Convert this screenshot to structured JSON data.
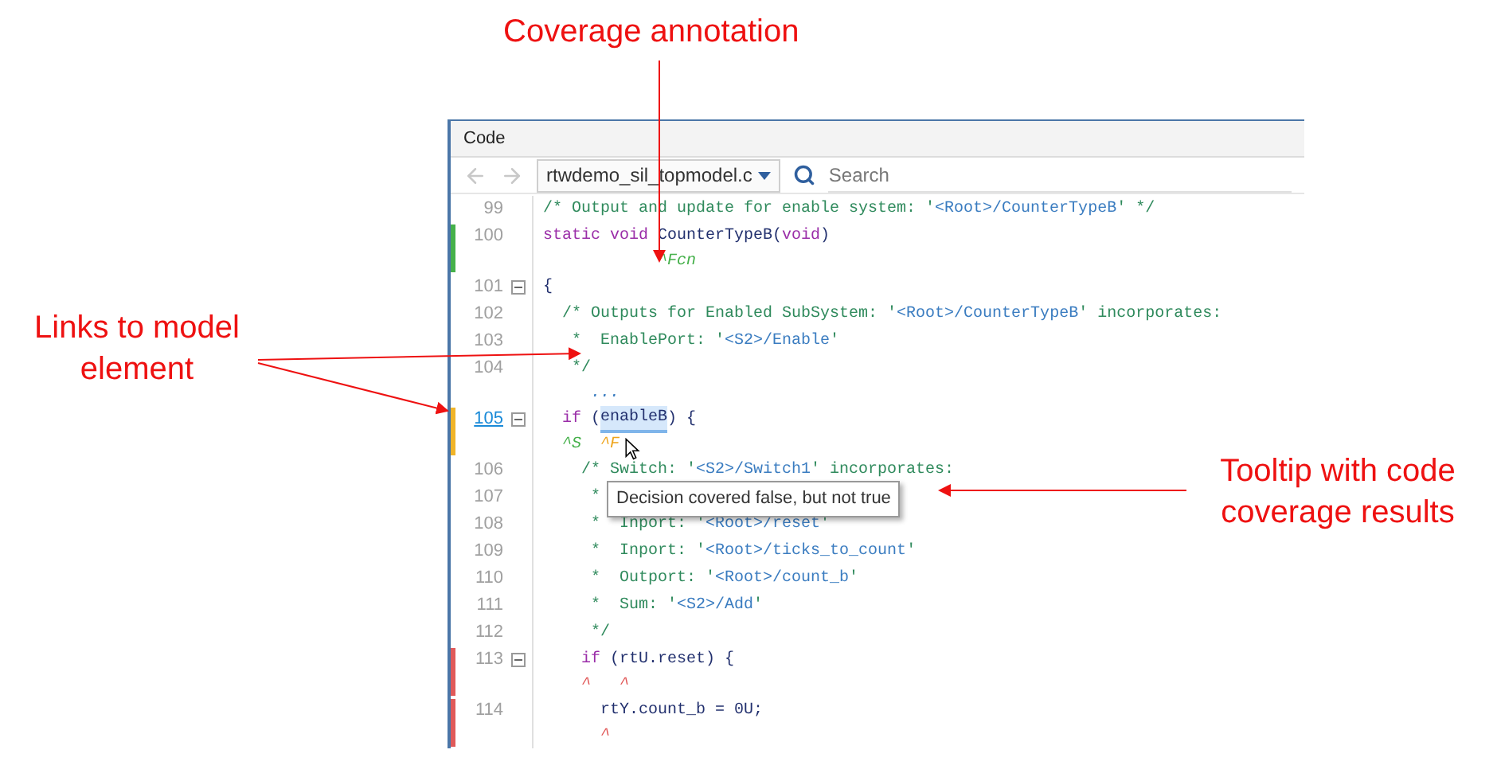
{
  "callouts": [
    {
      "text": "Coverage annotation"
    },
    {
      "text": "Links to model element"
    },
    {
      "text": "Tooltip with code coverage results"
    }
  ],
  "window": {
    "title": "Code"
  },
  "toolbar": {
    "file": "rtwdemo_sil_topmodel.c",
    "search_placeholder": "Search"
  },
  "lines": [
    {
      "number": "99",
      "linked": false,
      "collapsible": false,
      "tokens": [
        {
          "kind": "comment",
          "text": "/* Output and update for enable system: '"
        },
        {
          "kind": "link",
          "text": "<Root>/CounterTypeB"
        },
        {
          "kind": "comment",
          "text": "' */"
        }
      ]
    },
    {
      "number": "100",
      "linked": false,
      "collapsible": false,
      "color": "#45b04a",
      "tokens": [
        {
          "kind": "keyword",
          "text": "static void "
        },
        {
          "kind": "plain",
          "text": "CounterTypeB("
        },
        {
          "kind": "keyword",
          "text": "void"
        },
        {
          "kind": "plain",
          "text": ")"
        }
      ],
      "marks": [
        {
          "kind": "covered",
          "text": "            ^Fcn"
        }
      ]
    },
    {
      "number": "101",
      "linked": false,
      "collapsible": true,
      "tokens": [
        {
          "kind": "plain",
          "text": "{"
        }
      ]
    },
    {
      "number": "102",
      "linked": false,
      "collapsible": false,
      "tokens": [
        {
          "kind": "comment",
          "text": "  /* Outputs for Enabled SubSystem: '"
        },
        {
          "kind": "link",
          "text": "<Root>/CounterTypeB"
        },
        {
          "kind": "comment",
          "text": "' incorporates:"
        }
      ]
    },
    {
      "number": "103",
      "linked": false,
      "collapsible": false,
      "tokens": [
        {
          "kind": "comment",
          "text": "   *  EnablePort: '"
        },
        {
          "kind": "link",
          "text": "<S2>/Enable"
        },
        {
          "kind": "comment",
          "text": "'"
        }
      ]
    },
    {
      "number": "104",
      "linked": false,
      "collapsible": false,
      "tokens": [
        {
          "kind": "comment",
          "text": "   */"
        }
      ],
      "marks": [
        {
          "kind": "fold",
          "text": "     ..."
        }
      ]
    },
    {
      "number": "105",
      "linked": true,
      "collapsible": true,
      "color": "#f0b429",
      "tokens": [
        {
          "kind": "keyword",
          "text": "  if "
        },
        {
          "kind": "plain",
          "text": "("
        },
        {
          "kind": "plain",
          "text": "enableB",
          "highlighted": true
        },
        {
          "kind": "plain",
          "text": ") {"
        }
      ],
      "marks": [
        {
          "kind": "covered",
          "text": "  ^S"
        },
        {
          "kind": "partial",
          "text": "  ^F"
        }
      ]
    },
    {
      "number": "106",
      "linked": false,
      "collapsible": false,
      "tokens": [
        {
          "kind": "comment",
          "text": "    /* Switch: '"
        },
        {
          "kind": "link",
          "text": "<S2>/Switch1"
        },
        {
          "kind": "comment",
          "text": "' incorporates:"
        }
      ]
    },
    {
      "number": "107",
      "linked": false,
      "collapsible": false,
      "tokens": [
        {
          "kind": "comment",
          "text": "     *"
        }
      ]
    },
    {
      "number": "108",
      "linked": false,
      "collapsible": false,
      "tokens": [
        {
          "kind": "comment",
          "text": "     *  Inport: '"
        },
        {
          "kind": "link",
          "text": "<Root>/reset"
        },
        {
          "kind": "comment",
          "text": "'"
        }
      ]
    },
    {
      "number": "109",
      "linked": false,
      "collapsible": false,
      "tokens": [
        {
          "kind": "comment",
          "text": "     *  Inport: '"
        },
        {
          "kind": "link",
          "text": "<Root>/ticks_to_count"
        },
        {
          "kind": "comment",
          "text": "'"
        }
      ]
    },
    {
      "number": "110",
      "linked": false,
      "collapsible": false,
      "tokens": [
        {
          "kind": "comment",
          "text": "     *  Outport: '"
        },
        {
          "kind": "link",
          "text": "<Root>/count_b"
        },
        {
          "kind": "comment",
          "text": "'"
        }
      ]
    },
    {
      "number": "111",
      "linked": false,
      "collapsible": false,
      "tokens": [
        {
          "kind": "comment",
          "text": "     *  Sum: '"
        },
        {
          "kind": "link",
          "text": "<S2>/Add"
        },
        {
          "kind": "comment",
          "text": "'"
        }
      ]
    },
    {
      "number": "112",
      "linked": false,
      "collapsible": false,
      "tokens": [
        {
          "kind": "comment",
          "text": "     */"
        }
      ]
    },
    {
      "number": "113",
      "linked": false,
      "collapsible": true,
      "color": "#e05a5a",
      "tokens": [
        {
          "kind": "keyword",
          "text": "    if "
        },
        {
          "kind": "plain",
          "text": "(rtU.reset) {"
        }
      ],
      "marks": [
        {
          "kind": "missed",
          "text": "    ^"
        },
        {
          "kind": "missed",
          "text": "   ^"
        }
      ]
    },
    {
      "number": "114",
      "linked": false,
      "collapsible": false,
      "color": "#e05a5a",
      "tokens": [
        {
          "kind": "plain",
          "text": "      rtY.count_b = 0U;"
        }
      ],
      "marks": [
        {
          "kind": "missed",
          "text": "      ^"
        }
      ]
    }
  ],
  "tooltip": {
    "text": "Decision covered false, but not true"
  }
}
